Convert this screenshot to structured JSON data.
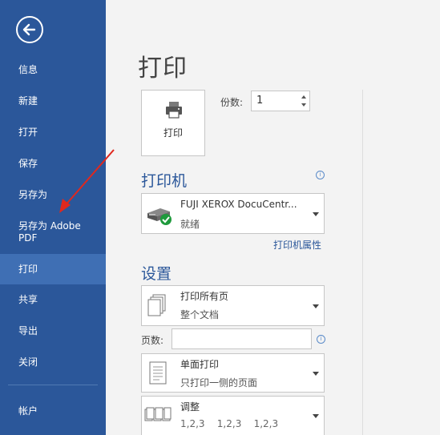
{
  "sidebar": {
    "items": [
      {
        "label": "信息"
      },
      {
        "label": "新建"
      },
      {
        "label": "打开"
      },
      {
        "label": "保存"
      },
      {
        "label": "另存为"
      },
      {
        "label": "另存为 Adobe PDF"
      },
      {
        "label": "打印",
        "active": true
      },
      {
        "label": "共享"
      },
      {
        "label": "导出"
      },
      {
        "label": "关闭"
      },
      {
        "label": "帐户"
      }
    ]
  },
  "main": {
    "title": "打印",
    "print_button_label": "打印",
    "copies": {
      "label": "份数:",
      "value": "1"
    },
    "printer_section": {
      "title": "打印机",
      "name": "FUJI XEROX DocuCentr...",
      "status": "就绪",
      "properties_link": "打印机属性"
    },
    "settings_section": {
      "title": "设置",
      "range": {
        "line1": "打印所有页",
        "line2": "整个文档"
      },
      "pages_label": "页数:",
      "pages_value": "",
      "sides": {
        "line1": "单面打印",
        "line2": "只打印一侧的页面"
      },
      "collate": {
        "line1": "调整",
        "line2": "1,2,3    1,2,3    1,2,3"
      }
    }
  },
  "colors": {
    "sidebar_bg": "#2b579a",
    "active_item": "#3f6fb4",
    "accent": "#2b579a",
    "annotation_arrow": "#e0281e"
  }
}
